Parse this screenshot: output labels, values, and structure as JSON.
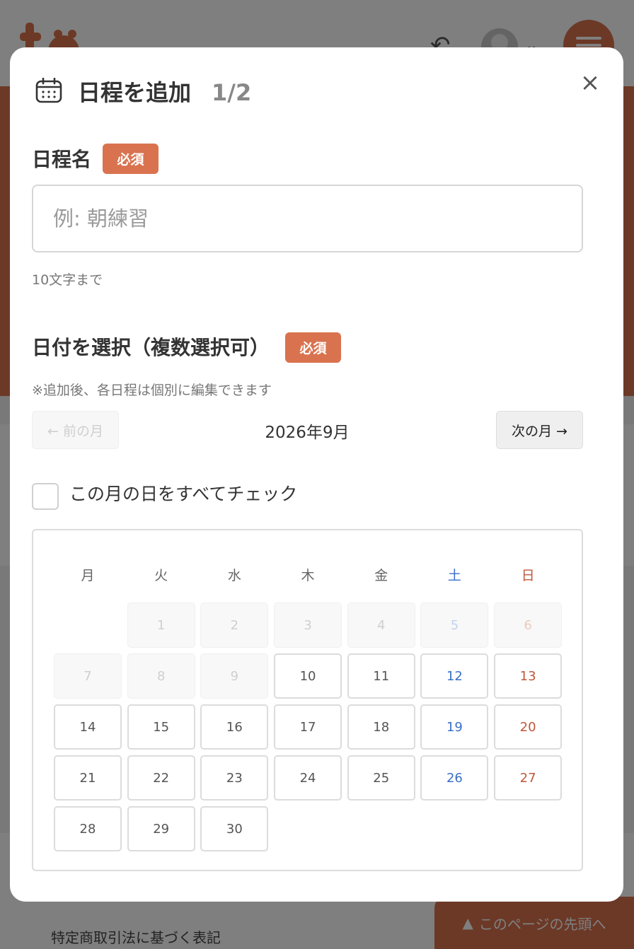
{
  "background": {
    "footer_link": "特定商取引法に基づく表記",
    "page_top_label": "このページの先頭へ",
    "page_top_icon": "▲"
  },
  "modal": {
    "title": "日程を追加",
    "step": "1/2",
    "close_glyph": "×",
    "name_field": {
      "label": "日程名",
      "required_badge": "必須",
      "placeholder": "例: 朝練習",
      "value": "",
      "hint": "10文字まで"
    },
    "date_picker": {
      "label": "日付を選択（複数選択可）",
      "required_badge": "必須",
      "note": "※追加後、各日程は個別に編集できます",
      "prev_label": "← 前の月",
      "next_label": "次の月 →",
      "month_label": "2026年9月",
      "check_all_label": "この月の日をすべてチェック",
      "check_all_checked": false,
      "weekdays": [
        "月",
        "火",
        "水",
        "木",
        "金",
        "土",
        "日"
      ],
      "leading_blank_cells": 1,
      "days": [
        {
          "d": "1",
          "enabled": false
        },
        {
          "d": "2",
          "enabled": false
        },
        {
          "d": "3",
          "enabled": false
        },
        {
          "d": "4",
          "enabled": false
        },
        {
          "d": "5",
          "enabled": false
        },
        {
          "d": "6",
          "enabled": false
        },
        {
          "d": "7",
          "enabled": false
        },
        {
          "d": "8",
          "enabled": false
        },
        {
          "d": "9",
          "enabled": false
        },
        {
          "d": "10",
          "enabled": true
        },
        {
          "d": "11",
          "enabled": true
        },
        {
          "d": "12",
          "enabled": true
        },
        {
          "d": "13",
          "enabled": true
        },
        {
          "d": "14",
          "enabled": true
        },
        {
          "d": "15",
          "enabled": true
        },
        {
          "d": "16",
          "enabled": true
        },
        {
          "d": "17",
          "enabled": true
        },
        {
          "d": "18",
          "enabled": true
        },
        {
          "d": "19",
          "enabled": true
        },
        {
          "d": "20",
          "enabled": true
        },
        {
          "d": "21",
          "enabled": true
        },
        {
          "d": "22",
          "enabled": true
        },
        {
          "d": "23",
          "enabled": true
        },
        {
          "d": "24",
          "enabled": true
        },
        {
          "d": "25",
          "enabled": true
        },
        {
          "d": "26",
          "enabled": true
        },
        {
          "d": "27",
          "enabled": true
        },
        {
          "d": "28",
          "enabled": true
        },
        {
          "d": "29",
          "enabled": true
        },
        {
          "d": "30",
          "enabled": true
        }
      ]
    }
  },
  "colors": {
    "accent": "#d9734f",
    "saturday": "#3a6fc8",
    "sunday": "#c0573b"
  }
}
